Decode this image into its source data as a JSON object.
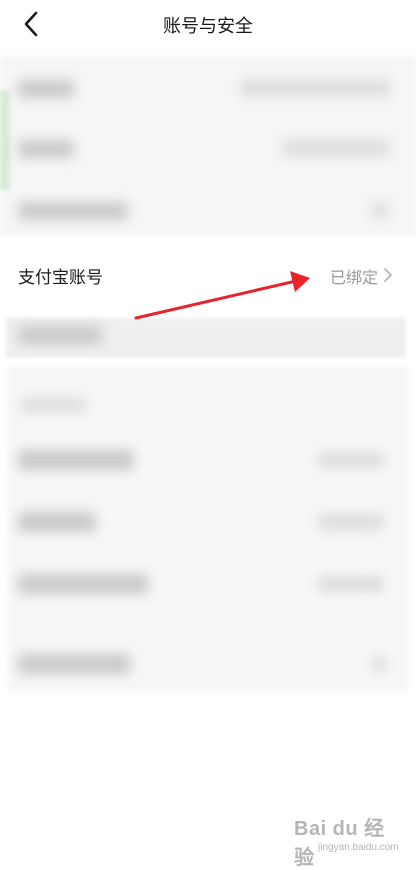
{
  "header": {
    "title": "账号与安全",
    "back_icon": "chevron-left-icon"
  },
  "rows": {
    "alipay": {
      "label": "支付宝账号",
      "status": "已绑定",
      "chevron_icon": "chevron-right-icon"
    }
  },
  "annotation": {
    "arrow_color": "#e8232a"
  },
  "watermark": {
    "text": "Bai du 经验",
    "sub": "jingyan.baidu.com"
  },
  "colors": {
    "status_text": "#9a9a9a",
    "background": "#ffffff"
  }
}
